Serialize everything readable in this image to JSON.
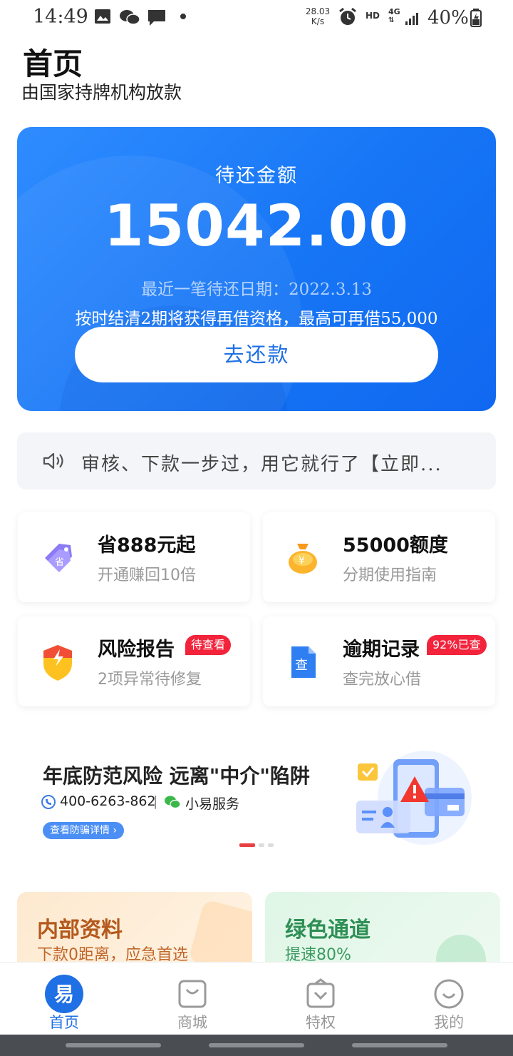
{
  "status_bar": {
    "time": "14:49",
    "net_speed_value": "28.03",
    "net_speed_unit": "K/s",
    "hd": "HD",
    "network": "4G",
    "battery": "40%"
  },
  "header": {
    "title": "首页",
    "subtitle": "由国家持牌机构放款"
  },
  "loan_card": {
    "label": "待还金额",
    "amount": "15042.00",
    "due_date": "最近一笔待还日期：2022.3.13",
    "promo": "按时结清2期将获得再借资格，最高可再借55,000",
    "repay_button": "去还款"
  },
  "notice": {
    "text": "审核、下款一步过，用它就行了【立即..."
  },
  "features": [
    {
      "title": "省888元起",
      "subtitle": "开通赚回10倍",
      "badge": "",
      "icon": "discount-tag-icon"
    },
    {
      "title": "55000额度",
      "subtitle": "分期使用指南",
      "badge": "",
      "icon": "money-bag-icon"
    },
    {
      "title": "风险报告",
      "subtitle": "2项异常待修复",
      "badge": "待查看",
      "icon": "shield-alert-icon"
    },
    {
      "title": "逾期记录",
      "subtitle": "查完放心借",
      "badge": "92%已查",
      "icon": "document-check-icon"
    }
  ],
  "banner": {
    "title": "年底防范风险  远离\"中介\"陷阱",
    "phone": "400-6263-862",
    "separator": "|",
    "wechat": "小易服务",
    "link": "查看防骗详情 ›"
  },
  "promo_cards": [
    {
      "title": "内部资料",
      "subtitle": "下款0距离，应急首选"
    },
    {
      "title": "绿色通道",
      "subtitle": "提速80%"
    }
  ],
  "bottom_nav": [
    {
      "label": "首页",
      "icon": "home-logo-icon",
      "active": true
    },
    {
      "label": "商城",
      "icon": "shopping-bag-icon",
      "active": false
    },
    {
      "label": "特权",
      "icon": "privilege-icon",
      "active": false
    },
    {
      "label": "我的",
      "icon": "profile-smile-icon",
      "active": false
    }
  ],
  "colors": {
    "brand_blue": "#1675f5",
    "badge_red": "#f2233b",
    "promo_orange": "#b4591c",
    "promo_green": "#2e8f55"
  }
}
